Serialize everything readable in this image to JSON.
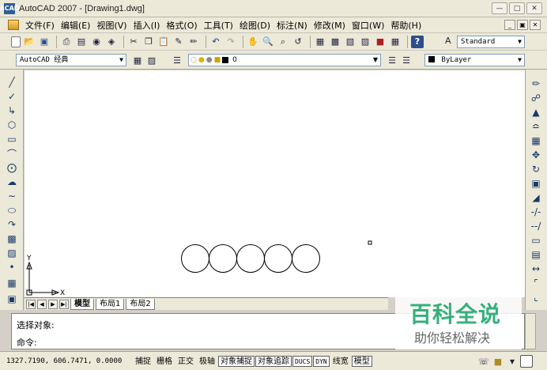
{
  "window": {
    "title": "AutoCAD 2007 - [Drawing1.dwg]",
    "app_icon": "ACAD"
  },
  "menu": {
    "items": [
      "文件(F)",
      "编辑(E)",
      "视图(V)",
      "插入(I)",
      "格式(O)",
      "工具(T)",
      "绘图(D)",
      "标注(N)",
      "修改(M)",
      "窗口(W)",
      "帮助(H)"
    ]
  },
  "toolbar": {
    "text_style": "Standard"
  },
  "workspace": {
    "selected": "AutoCAD 经典"
  },
  "layer": {
    "selected": "0"
  },
  "properties": {
    "color": "ByLayer"
  },
  "tabs": [
    "模型",
    "布局1",
    "布局2"
  ],
  "command": {
    "line1": "选择对象:",
    "line2": "命令:"
  },
  "status": {
    "coordinates": "1327.7190, 606.7471, 0.0000",
    "buttons": [
      {
        "label": "捕捉",
        "pressed": false
      },
      {
        "label": "栅格",
        "pressed": false
      },
      {
        "label": "正交",
        "pressed": false
      },
      {
        "label": "极轴",
        "pressed": false
      },
      {
        "label": "对象捕捉",
        "pressed": true
      },
      {
        "label": "对象追踪",
        "pressed": true
      },
      {
        "label": "DUCS",
        "pressed": true
      },
      {
        "label": "DYN",
        "pressed": true
      },
      {
        "label": "线宽",
        "pressed": false
      },
      {
        "label": "模型",
        "pressed": true
      }
    ]
  },
  "ucs": {
    "x_label": "X",
    "y_label": "Y"
  },
  "watermark": {
    "title": "百科全说",
    "subtitle": "助你轻松解决"
  },
  "colors": {
    "canvas": "#ffffff",
    "chrome": "#ece9d8",
    "watermark_green": "#36b07a"
  }
}
